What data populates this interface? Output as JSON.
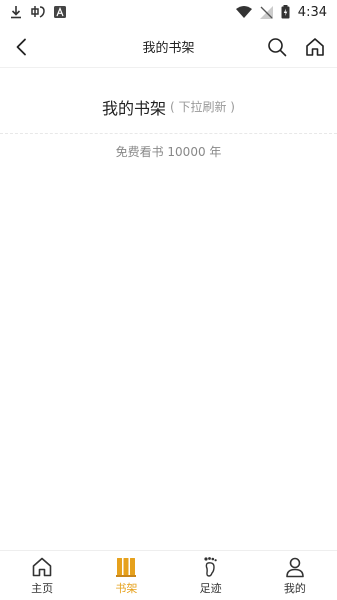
{
  "status_bar": {
    "time": "4:34",
    "icons": [
      "download-icon",
      "app-icon",
      "a-icon",
      "wifi-icon",
      "no-signal-icon",
      "battery-icon"
    ]
  },
  "nav": {
    "title": "我的书架",
    "back_icon": "back-chevron-icon",
    "search_icon": "search-icon",
    "home_icon": "home-icon"
  },
  "shelf": {
    "title": "我的书架",
    "hint": "( 下拉刷新 )",
    "free_text": "免费看书 10000 年"
  },
  "tabs": [
    {
      "label": "主页",
      "icon": "home-icon",
      "active": false
    },
    {
      "label": "书架",
      "icon": "bookshelf-icon",
      "active": true
    },
    {
      "label": "足迹",
      "icon": "footprint-icon",
      "active": false
    },
    {
      "label": "我的",
      "icon": "profile-icon",
      "active": false
    }
  ],
  "colors": {
    "accent": "#e6a11c",
    "text": "#222222",
    "muted": "#888888"
  }
}
